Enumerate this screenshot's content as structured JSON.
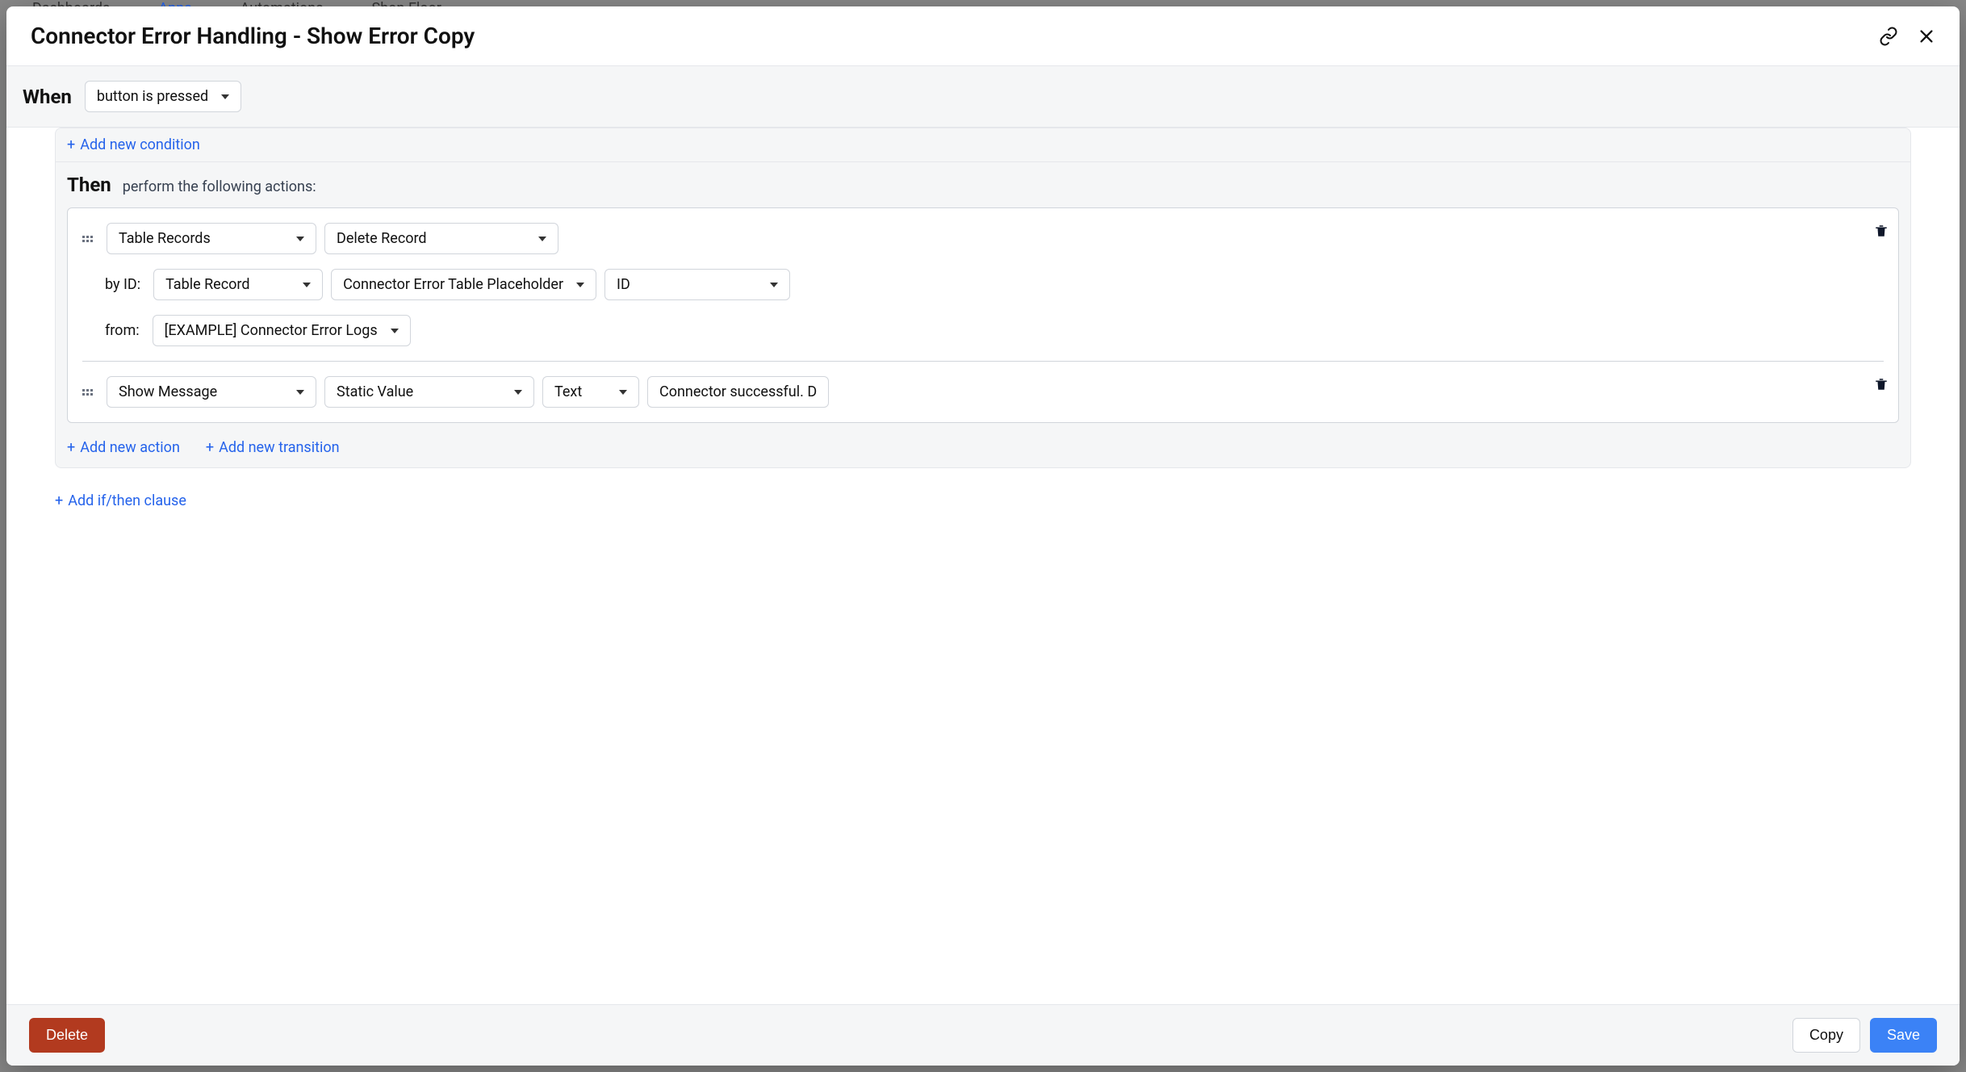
{
  "background_nav": {
    "dashboards": "Dashboards",
    "apps": "Apps",
    "automations": "Automations",
    "shop": "Shop Floor"
  },
  "modal": {
    "title": "Connector Error Handling - Show Error Copy"
  },
  "when": {
    "label": "When",
    "dropdown": "button is pressed"
  },
  "links": {
    "add_condition": "Add new condition",
    "add_action": "Add new action",
    "add_transition": "Add new transition",
    "add_clause": "Add if/then clause"
  },
  "then": {
    "label": "Then",
    "subtext": "perform the following actions:"
  },
  "action1": {
    "type": "Table Records",
    "op": "Delete Record",
    "by_id_label": "by ID:",
    "by_id_source": "Table Record",
    "by_id_target": "Connector Error Table Placeholder",
    "by_id_field": "ID",
    "from_label": "from:",
    "from_value": "[EXAMPLE] Connector Error Logs"
  },
  "action2": {
    "type": "Show Message",
    "source": "Static Value",
    "mode": "Text",
    "value": "Connector successful. D"
  },
  "footer": {
    "delete": "Delete",
    "copy": "Copy",
    "save": "Save"
  }
}
